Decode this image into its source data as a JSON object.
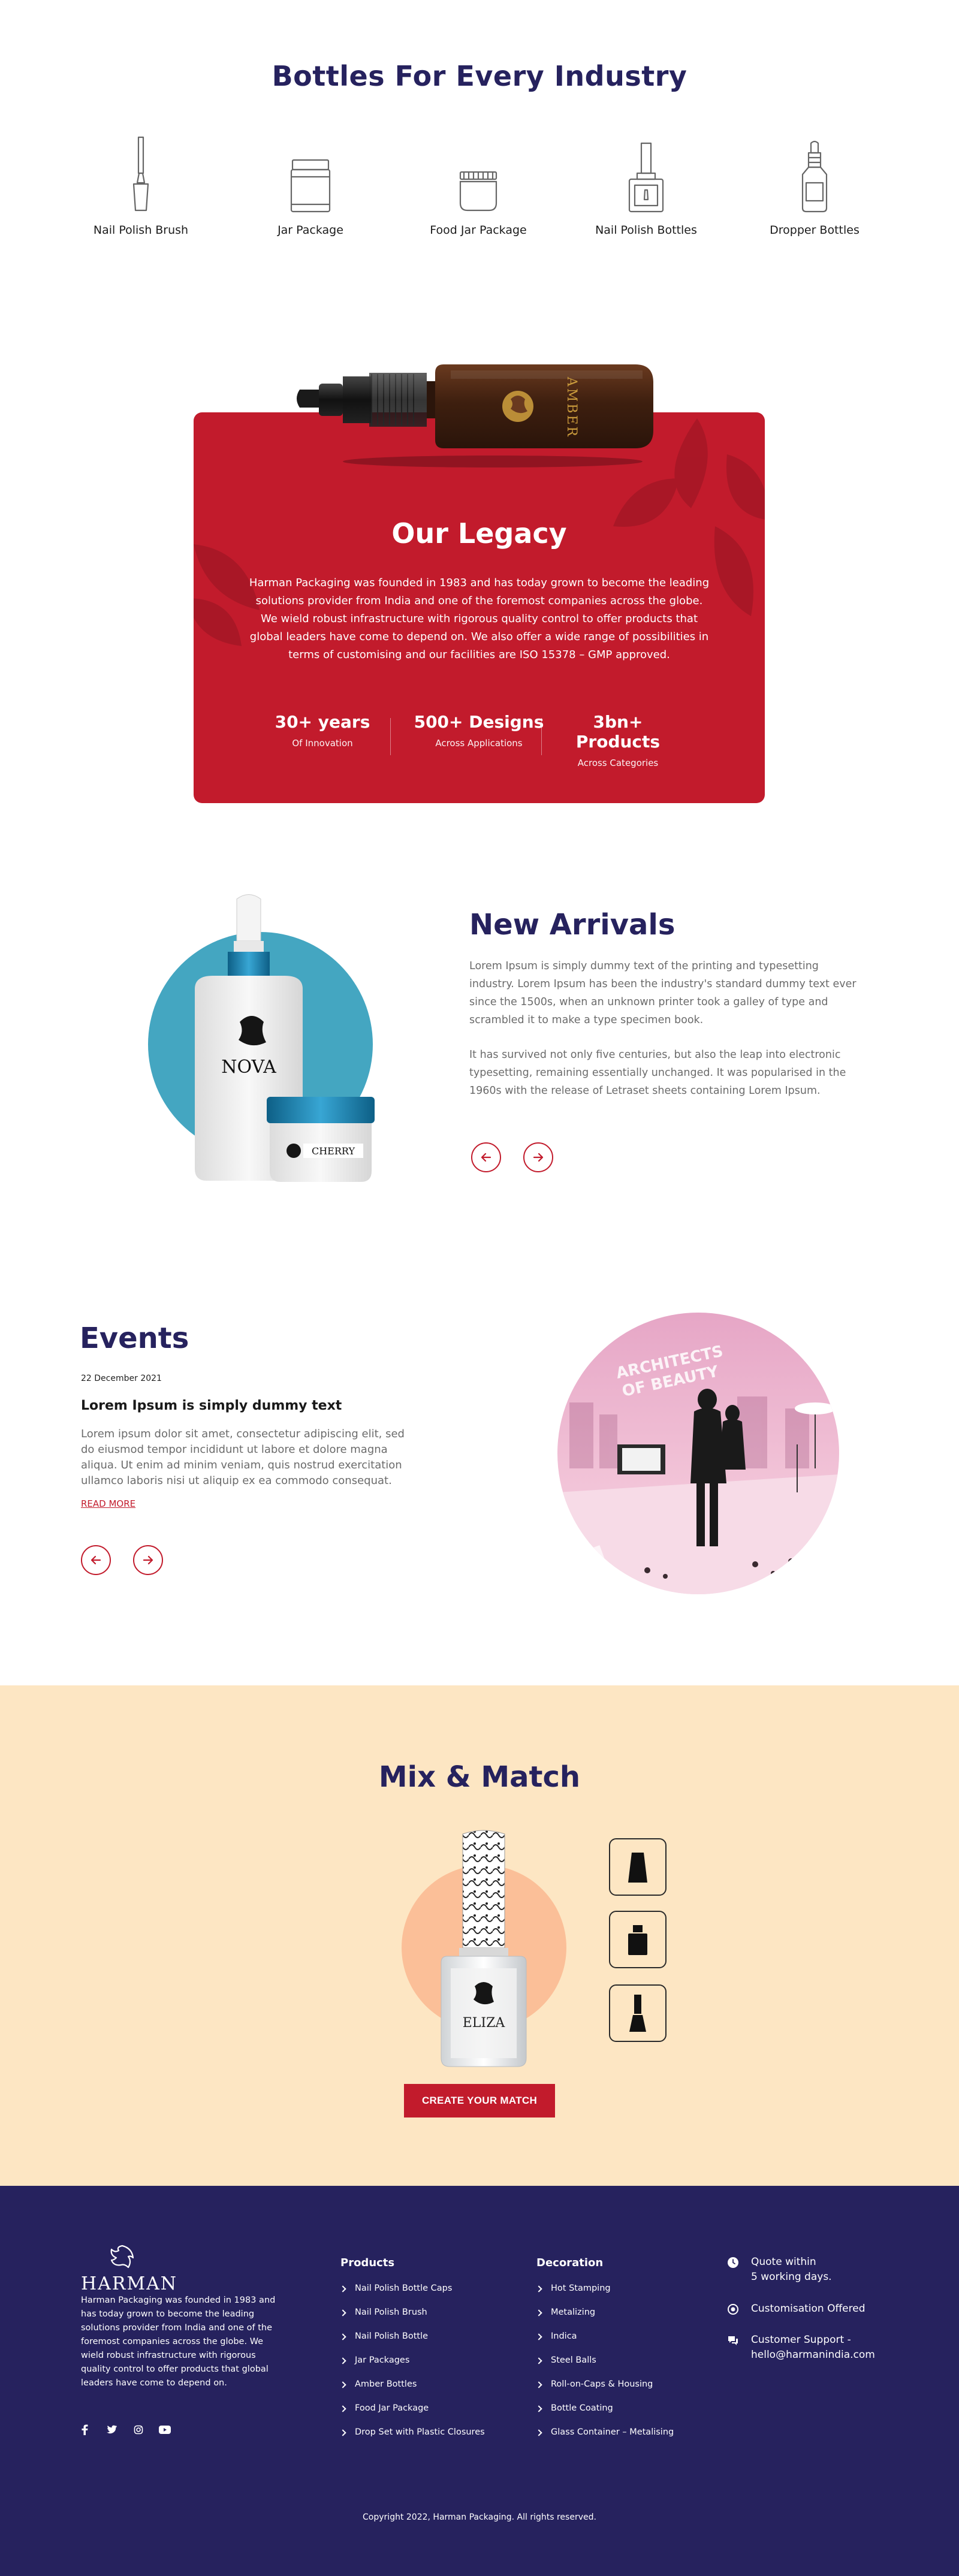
{
  "industry": {
    "title": "Bottles For Every Industry",
    "items": [
      {
        "label": "Nail Polish Brush",
        "icon": "nail-polish-brush-icon"
      },
      {
        "label": "Jar Package",
        "icon": "jar-package-icon"
      },
      {
        "label": "Food Jar Package",
        "icon": "food-jar-icon"
      },
      {
        "label": "Nail Polish Bottles",
        "icon": "nail-polish-bottle-icon"
      },
      {
        "label": "Dropper Bottles",
        "icon": "dropper-bottle-icon"
      }
    ]
  },
  "legacy": {
    "title": "Our Legacy",
    "body": "Harman Packaging was founded in 1983 and has today grown to become the leading solutions provider from India and one of the foremost companies across the globe. We wield robust infrastructure with rigorous quality control to offer products that global leaders have come to depend on. We also offer a wide range of possibilities in terms of customising and our facilities are ISO 15378 – GMP approved.",
    "bottle_label": "AMBER",
    "stats": [
      {
        "value": "30+ years",
        "label": "Of Innovation"
      },
      {
        "value": "500+ Designs",
        "label": "Across Applications"
      },
      {
        "value": "3bn+ Products",
        "label": "Across Categories"
      }
    ]
  },
  "arrivals": {
    "title": "New Arrivals",
    "paragraph_1": "Lorem Ipsum is simply dummy text of the printing and typesetting industry. Lorem Ipsum has been the industry's standard dummy text ever since the 1500s, when an unknown printer took a galley of type and scrambled it to make a type specimen book.",
    "paragraph_2": "It has survived not only five centuries, but also the leap into electronic typesetting, remaining essentially unchanged. It was popularised in the 1960s with the release of Letraset sheets containing Lorem Ipsum.",
    "product_1": "NOVA",
    "product_2": "CHERRY",
    "prev_icon": "arrow-left-icon",
    "next_icon": "arrow-right-icon"
  },
  "events": {
    "title": "Events",
    "date": "22 December 2021",
    "heading": "Lorem Ipsum is simply dummy text",
    "body": "Lorem ipsum dolor sit amet, consectetur adipiscing elit, sed do eiusmod tempor incididunt ut labore et dolore magna aliqua. Ut enim ad minim veniam, quis nostrud exercitation ullamco laboris nisi ut aliquip ex ea commodo consequat.",
    "read_more": "READ MORE",
    "photo_text_1": "ARCHITECTS",
    "photo_text_2": "OF BEAUTY"
  },
  "mix": {
    "title": "Mix & Match",
    "bottle_label": "ELIZA",
    "cta": "CREATE YOUR MATCH",
    "options": [
      "cap-short-icon",
      "cap-square-icon",
      "cap-brush-icon"
    ]
  },
  "footer": {
    "logo_text": "HARMAN",
    "about": "Harman Packaging was founded in 1983 and has today grown to become the leading solutions provider from India and one of the foremost companies across the globe. We wield robust infrastructure with rigorous quality control to offer products that global leaders have come to depend on.",
    "products_title": "Products",
    "products": [
      "Nail Polish Bottle Caps",
      "Nail Polish Brush",
      "Nail Polish Bottle",
      "Jar Packages",
      "Amber Bottles",
      "Food Jar Package",
      "Drop Set with Plastic Closures"
    ],
    "decoration_title": "Decoration",
    "decoration": [
      "Hot Stamping",
      "Metalizing",
      "Indica",
      "Steel Balls",
      "Roll-on-Caps & Housing",
      "Bottle Coating",
      "Glass Container – Metalising"
    ],
    "contact": [
      {
        "text": "Quote within",
        "text2": "5 working days.",
        "icon": "clock-icon"
      },
      {
        "text": "Customisation Offered",
        "icon": "settings-icon"
      },
      {
        "text": "Customer Support -",
        "text2": "hello@harmanindia.com",
        "icon": "chat-icon"
      }
    ],
    "social": [
      "facebook-icon",
      "twitter-icon",
      "instagram-icon",
      "youtube-icon"
    ],
    "copyright": "Copyright 2022, Harman Packaging. All rights reserved."
  },
  "colors": {
    "brand_navy": "#26225e",
    "brand_red": "#c21b2c",
    "arrivals_circle": "#44a6c1",
    "mix_bg": "#fde6c3",
    "mix_circle": "#fbbf98"
  }
}
